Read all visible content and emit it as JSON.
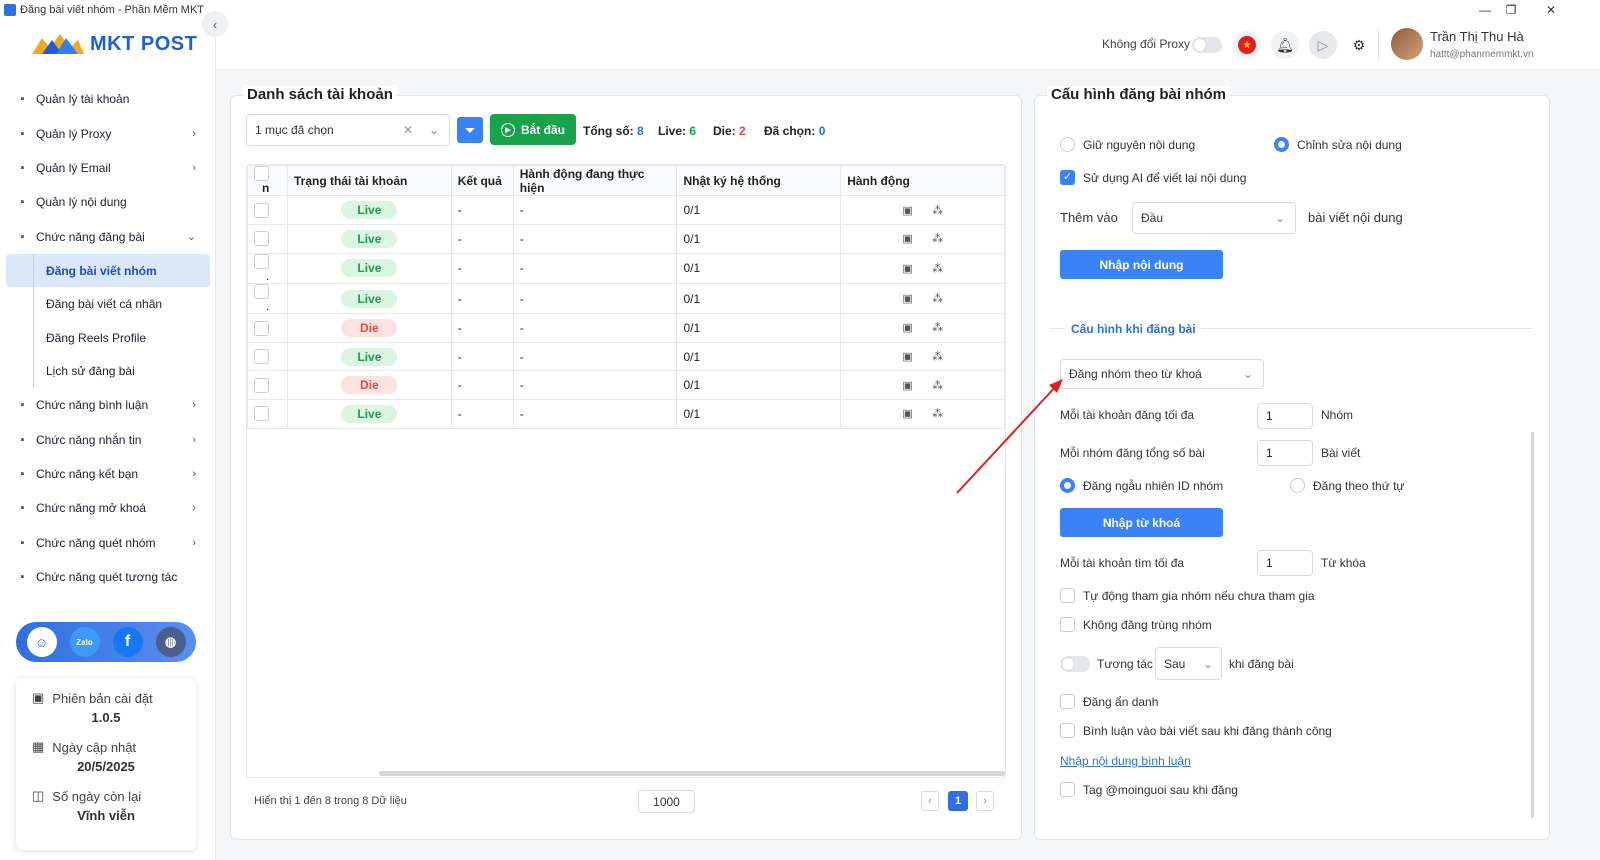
{
  "window": {
    "title": "Đăng bài viết nhóm - Phần Mềm MKT"
  },
  "logo": {
    "text": "MKT POST"
  },
  "sidebar": {
    "items": [
      {
        "label": "Quản lý tài khoản",
        "icon": "grid-icon",
        "chevron": ""
      },
      {
        "label": "Quản lý Proxy",
        "icon": "layers-icon",
        "chevron": "›"
      },
      {
        "label": "Quản lý Email",
        "icon": "mail-icon",
        "chevron": "›"
      },
      {
        "label": "Quản lý nội dung",
        "icon": "content-icon",
        "chevron": ""
      },
      {
        "label": "Chức năng đăng bài",
        "icon": "post-icon",
        "chevron": "⌄"
      }
    ],
    "sub_items": [
      {
        "label": "Đăng bài viết nhóm",
        "active": true
      },
      {
        "label": "Đăng bài viết cá nhân",
        "active": false
      },
      {
        "label": "Đăng Reels Profile",
        "active": false
      },
      {
        "label": "Lịch sử đăng bài",
        "active": false
      }
    ],
    "items_after": [
      {
        "label": "Chức năng bình luận",
        "icon": "comment-icon",
        "chevron": "›"
      },
      {
        "label": "Chức năng nhắn tin",
        "icon": "message-icon",
        "chevron": "›"
      },
      {
        "label": "Chức năng kết bạn",
        "icon": "add-friend-icon",
        "chevron": "›"
      },
      {
        "label": "Chức năng mở khoá",
        "icon": "lock-icon",
        "chevron": "›"
      },
      {
        "label": "Chức năng quét nhóm",
        "icon": "group-icon",
        "chevron": "›"
      },
      {
        "label": "Chức năng quét tương tác",
        "icon": "scan-icon",
        "chevron": ""
      }
    ]
  },
  "social": {
    "zalo": "Zalo"
  },
  "info": {
    "version_label": "Phiên bản cài đặt",
    "version": "1.0.5",
    "update_label": "Ngày cập nhật",
    "update": "20/5/2025",
    "days_label": "Số ngày còn lại",
    "days": "Vĩnh viễn"
  },
  "topbar": {
    "proxy_label": "Không đổi Proxy",
    "user_name": "Trần Thị Thu Hà",
    "user_email": "hattt@phanmemmkt.vn"
  },
  "accounts": {
    "title": "Danh sách tài khoản",
    "select_value": "1 mục đã chọn",
    "start_label": "Bắt đầu",
    "total_label": "Tổng số:",
    "total": "8",
    "live_label": "Live:",
    "live": "6",
    "die_label": "Die:",
    "die": "2",
    "selected_label": "Đã chọn:",
    "selected": "0",
    "columns": [
      "n",
      "Trạng thái tài khoản",
      "Kết quả",
      "Hành động đang thực hiện",
      "Nhật ký hệ thống",
      "Hành động"
    ],
    "rows": [
      {
        "prefix": "",
        "status": "Live",
        "result": "-",
        "action": "-",
        "log": "0/1"
      },
      {
        "prefix": "",
        "status": "Live",
        "result": "-",
        "action": "-",
        "log": "0/1"
      },
      {
        "prefix": ".",
        "status": "Live",
        "result": "-",
        "action": "-",
        "log": "0/1"
      },
      {
        "prefix": ".",
        "status": "Live",
        "result": "-",
        "action": "-",
        "log": "0/1"
      },
      {
        "prefix": "",
        "status": "Die",
        "result": "-",
        "action": "-",
        "log": "0/1"
      },
      {
        "prefix": "",
        "status": "Live",
        "result": "-",
        "action": "-",
        "log": "0/1"
      },
      {
        "prefix": "",
        "status": "Die",
        "result": "-",
        "action": "-",
        "log": "0/1"
      },
      {
        "prefix": "",
        "status": "Live",
        "result": "-",
        "action": "-",
        "log": "0/1"
      }
    ],
    "footer_text": "Hiển thị 1 đến 8 trong 8 Dữ liệu",
    "page_size": "1000",
    "current_page": "1"
  },
  "config": {
    "title": "Cấu hình đăng bài nhóm",
    "keep_content": "Giữ nguyên nội dung",
    "edit_content": "Chỉnh sửa nội dung",
    "use_ai": "Sử dụng AI để viết lại nội dung",
    "add_to_label": "Thêm vào",
    "add_to_value": "Đầu",
    "add_to_suffix": "bài viết nội dung",
    "import_content_btn": "Nhập nội dung",
    "section_title": "Cấu hình khi đăng bài",
    "post_mode": "Đăng nhóm theo từ khoá",
    "max_groups_label": "Mỗi tài khoản đăng tối đa",
    "max_groups": "1",
    "max_groups_unit": "Nhóm",
    "posts_per_group_label": "Mỗi nhóm đăng tổng số bài",
    "posts_per_group": "1",
    "posts_per_group_unit": "Bài viết",
    "random_id": "Đăng ngẫu nhiên ID nhóm",
    "ordered": "Đăng theo thứ tự",
    "import_keyword_btn": "Nhập từ khoá",
    "max_search_label": "Mỗi tài khoản tìm tối đa",
    "max_search": "1",
    "max_search_unit": "Từ khóa",
    "auto_join": "Tự động tham gia nhóm nếu chưa tham gia",
    "no_duplicate": "Không đăng trùng nhóm",
    "interact_label": "Tương tác",
    "interact_value": "Sau",
    "interact_suffix": "khi đăng bài",
    "anonymous": "Đăng ẩn danh",
    "comment_after": "Bình luận vào bài viết sau khi đăng thành công",
    "comment_link": "Nhập nội dung bình luận",
    "tag_everyone": "Tag @moinguoi sau khi đăng"
  },
  "colors": {
    "primary": "#3b82f6",
    "green": "#16a34a",
    "live": "#1f9d4a",
    "die": "#e04848",
    "arrow": "#e02020"
  }
}
